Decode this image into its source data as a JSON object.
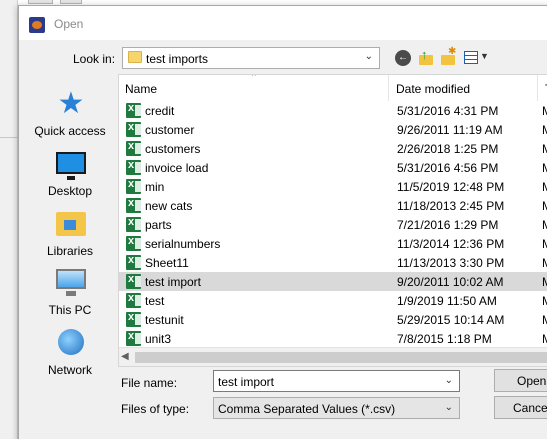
{
  "dialog": {
    "title": "Open",
    "look_in_label": "Look in:",
    "look_in_value": "test imports"
  },
  "places": [
    {
      "label": "Quick access",
      "icon": "star-icon"
    },
    {
      "label": "Desktop",
      "icon": "desktop-icon"
    },
    {
      "label": "Libraries",
      "icon": "libraries-icon"
    },
    {
      "label": "This PC",
      "icon": "computer-icon"
    },
    {
      "label": "Network",
      "icon": "network-icon"
    }
  ],
  "columns": {
    "name": "Name",
    "date": "Date modified",
    "type": "Ty"
  },
  "files": [
    {
      "name": "credit",
      "date": "5/31/2016 4:31 PM",
      "type": "M"
    },
    {
      "name": "customer",
      "date": "9/26/2011 11:19 AM",
      "type": "M"
    },
    {
      "name": "customers",
      "date": "2/26/2018 1:25 PM",
      "type": "M"
    },
    {
      "name": "invoice load",
      "date": "5/31/2016 4:56 PM",
      "type": "M"
    },
    {
      "name": "min",
      "date": "11/5/2019 12:48 PM",
      "type": "M"
    },
    {
      "name": "new cats",
      "date": "11/18/2013 2:45 PM",
      "type": "M"
    },
    {
      "name": "parts",
      "date": "7/21/2016 1:29 PM",
      "type": "M"
    },
    {
      "name": "serialnumbers",
      "date": "11/3/2014 12:36 PM",
      "type": "M"
    },
    {
      "name": "Sheet11",
      "date": "11/13/2013 3:30 PM",
      "type": "M"
    },
    {
      "name": "test import",
      "date": "9/20/2011 10:02 AM",
      "type": "M",
      "selected": true
    },
    {
      "name": "test",
      "date": "1/9/2019 11:50 AM",
      "type": "M"
    },
    {
      "name": "testunit",
      "date": "5/29/2015 10:14 AM",
      "type": "M"
    },
    {
      "name": "unit3",
      "date": "7/8/2015 1:18 PM",
      "type": "M"
    }
  ],
  "bottom": {
    "file_name_label": "File name:",
    "file_name_value": "test import",
    "file_type_label": "Files of type:",
    "file_type_value": "Comma Separated Values (*.csv)"
  },
  "buttons": {
    "open": "Open",
    "cancel": "Cance"
  },
  "colors": {
    "selection": "#d9d9d9",
    "dialog_bg": "#f0f0f0",
    "excel_green": "#1f7a3f"
  }
}
